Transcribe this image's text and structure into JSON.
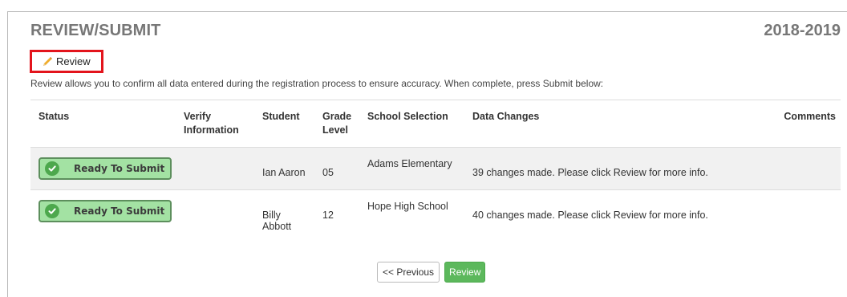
{
  "header": {
    "title": "REVIEW/SUBMIT",
    "school_year": "2018-2019"
  },
  "review_link": {
    "icon": "pencil-icon",
    "label": "Review"
  },
  "instructions": "Review allows you to confirm all data entered during the registration process to ensure accuracy. When complete, press Submit below:",
  "table": {
    "columns": {
      "status": "Status",
      "verify_line1": "Verify",
      "verify_line2": "Information",
      "student": "Student",
      "grade_line1": "Grade",
      "grade_line2": "Level",
      "school": "School Selection",
      "changes": "Data Changes",
      "comments": "Comments"
    },
    "rows": [
      {
        "status": "Ready To Submit",
        "verify": "",
        "student": "Ian Aaron",
        "grade": "05",
        "school": "Adams Elementary",
        "changes": "39 changes made. Please click Review for more info.",
        "comments": ""
      },
      {
        "status": "Ready To Submit",
        "verify": "",
        "student": "Billy Abbott",
        "grade": "12",
        "school": "Hope High School",
        "changes": "40 changes made. Please click Review for more info.",
        "comments": ""
      }
    ]
  },
  "footer": {
    "previous_label": "<< Previous",
    "review_label": "Review"
  },
  "colors": {
    "accent_green": "#5cb85c",
    "badge_green": "#a3e2a3",
    "highlight_red": "#e3141c"
  }
}
